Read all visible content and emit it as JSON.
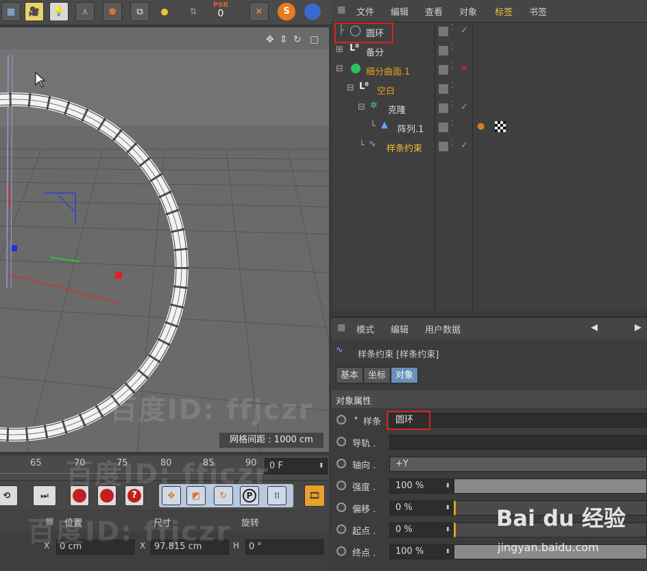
{
  "object_manager": {
    "menu": [
      "文件",
      "编辑",
      "查看",
      "对象",
      "标签",
      "书签"
    ],
    "objects": [
      {
        "name": "圆环",
        "color": "#dcdcdc"
      },
      {
        "name": "备分",
        "color": "#dcdcdc"
      },
      {
        "name": "细分曲面.1",
        "color": "#e0a020"
      },
      {
        "name": "空白",
        "color": "#e0a020"
      },
      {
        "name": "克隆",
        "color": "#dcdcdc"
      },
      {
        "name": "阵列.1",
        "color": "#dcdcdc"
      },
      {
        "name": "样条约束",
        "color": "#f0c030"
      }
    ]
  },
  "attribute_manager": {
    "menu": [
      "模式",
      "编辑",
      "用户数据"
    ],
    "title": "样条约束 [样条约束]",
    "tabs": [
      "基本",
      "坐标",
      "对象"
    ],
    "section": "对象属性",
    "props": [
      {
        "label": "样条",
        "value": "圆环"
      },
      {
        "label": "导轨 .",
        "value": ""
      },
      {
        "label": "轴向 .",
        "value": "+Y"
      },
      {
        "label": "强度 .",
        "value": "100 %",
        "level": 1.0
      },
      {
        "label": "偏移 .",
        "value": "0 %",
        "level": 0.0
      },
      {
        "label": "起点 .",
        "value": "0 %",
        "level": 0.0
      },
      {
        "label": "终点 .",
        "value": "100 %",
        "level": 1.0
      }
    ]
  },
  "viewport": {
    "grid_label": "网格间距 : 1000 cm"
  },
  "toolbar": {
    "psr_label": "PSR",
    "psr_value": "0"
  },
  "timeline": {
    "ticks": [
      "65",
      "70",
      "75",
      "80",
      "85",
      "90"
    ],
    "frame": "0 F"
  },
  "coords": {
    "headers": [
      "位置",
      "尺寸",
      "旋转"
    ],
    "x_label": "X",
    "x_pos": "0 cm",
    "x_size": "97.815 cm",
    "h_label": "H",
    "h_rot": "0 °"
  },
  "watermarks": [
    "百度ID: ffjczr",
    "百度ID: ffjczr",
    "百度ID: ffjczr"
  ],
  "baidu": {
    "logo": "Bai du 经验",
    "url": "jingyan.baidu.com"
  }
}
